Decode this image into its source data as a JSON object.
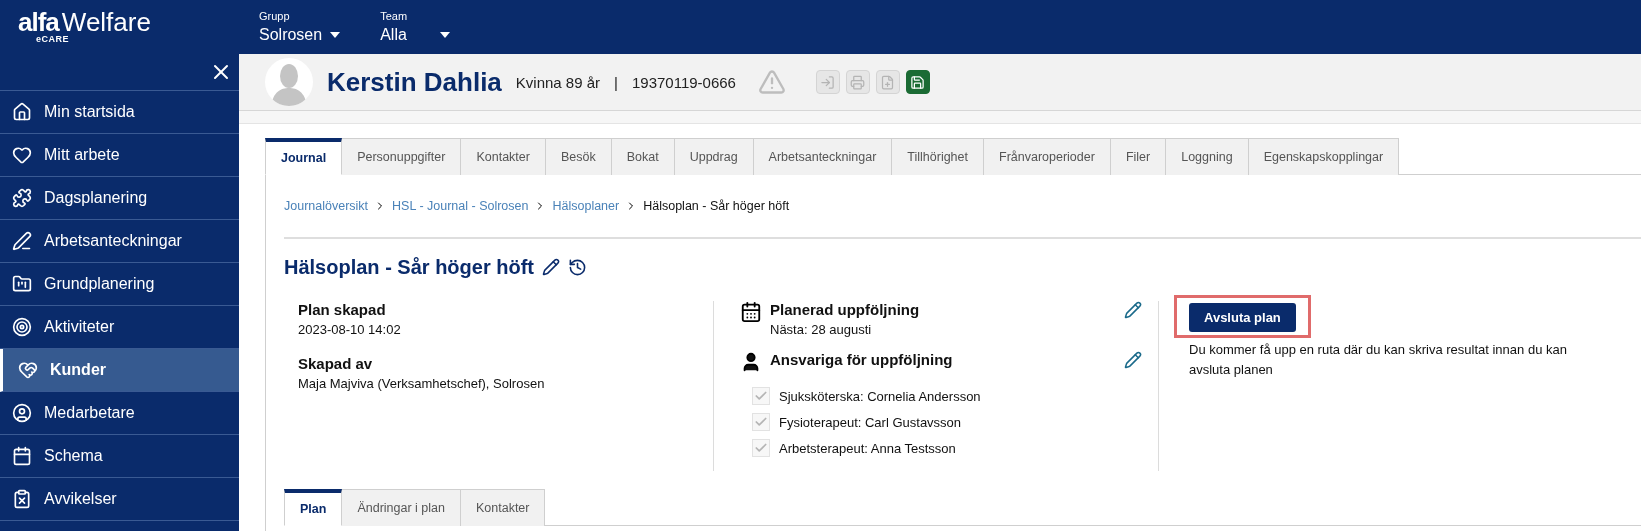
{
  "brand": {
    "logo_main": "alfa",
    "logo_second": "Welfare",
    "logo_sub": "eCARE"
  },
  "selectors": [
    {
      "label": "Grupp",
      "value": "Solrosen"
    },
    {
      "label": "Team",
      "value": "Alla"
    }
  ],
  "sidebar": {
    "items": [
      {
        "label": "Min startsida",
        "selected": false
      },
      {
        "label": "Mitt arbete",
        "selected": false
      },
      {
        "label": "Dagsplanering",
        "selected": false
      },
      {
        "label": "Arbetsanteckningar",
        "selected": false
      },
      {
        "label": "Grundplanering",
        "selected": false
      },
      {
        "label": "Aktiviteter",
        "selected": false
      },
      {
        "label": "Kunder",
        "selected": true
      },
      {
        "label": "Medarbetare",
        "selected": false
      },
      {
        "label": "Schema",
        "selected": false
      },
      {
        "label": "Avvikelser",
        "selected": false
      }
    ]
  },
  "patient": {
    "name": "Kerstin Dahlia",
    "info": "Kvinna 89 år",
    "separator": "|",
    "id": "19370119-0666"
  },
  "header_actions": [
    {
      "disabled": true
    },
    {
      "disabled": true
    },
    {
      "disabled": true
    },
    {
      "disabled": false
    }
  ],
  "tabs": [
    {
      "label": "Journal",
      "selected": true
    },
    {
      "label": "Personuppgifter",
      "selected": false
    },
    {
      "label": "Kontakter",
      "selected": false
    },
    {
      "label": "Besök",
      "selected": false
    },
    {
      "label": "Bokat",
      "selected": false
    },
    {
      "label": "Uppdrag",
      "selected": false
    },
    {
      "label": "Arbetsanteckningar",
      "selected": false
    },
    {
      "label": "Tillhörighet",
      "selected": false
    },
    {
      "label": "Frånvaroperioder",
      "selected": false
    },
    {
      "label": "Filer",
      "selected": false
    },
    {
      "label": "Loggning",
      "selected": false
    },
    {
      "label": "Egenskapskopplingar",
      "selected": false
    }
  ],
  "breadcrumb": [
    {
      "label": "Journalöversikt",
      "kind": "link"
    },
    {
      "label": "HSL - Journal - Solrosen",
      "kind": "link"
    },
    {
      "label": "Hälsoplaner",
      "kind": "link"
    },
    {
      "label": "Hälsoplan - Sår höger höft",
      "kind": "current"
    }
  ],
  "plan": {
    "title": "Hälsoplan - Sår höger höft",
    "created_label": "Plan skapad",
    "created_value": "2023-08-10 14:02",
    "author_label": "Skapad av",
    "author_value": "Maja Majviva (Verksamhetschef), Solrosen",
    "followup_label": "Planerad uppföljning",
    "followup_value": "Nästa: 28 augusti",
    "responsible_label": "Ansvariga för uppföljning",
    "responsible": [
      {
        "label": "Sjuksköterska: Cornelia Andersson",
        "checked": true
      },
      {
        "label": "Fysioterapeut: Carl Gustavsson",
        "checked": true
      },
      {
        "label": "Arbetsterapeut: Anna Testsson",
        "checked": true
      }
    ],
    "close_button": "Avsluta plan",
    "close_hint": "Du kommer få upp en ruta där du kan skriva resultat innan du kan avsluta planen"
  },
  "sub_tabs": [
    {
      "label": "Plan",
      "selected": true
    },
    {
      "label": "Ändringar i plan",
      "selected": false
    },
    {
      "label": "Kontakter",
      "selected": false
    }
  ]
}
